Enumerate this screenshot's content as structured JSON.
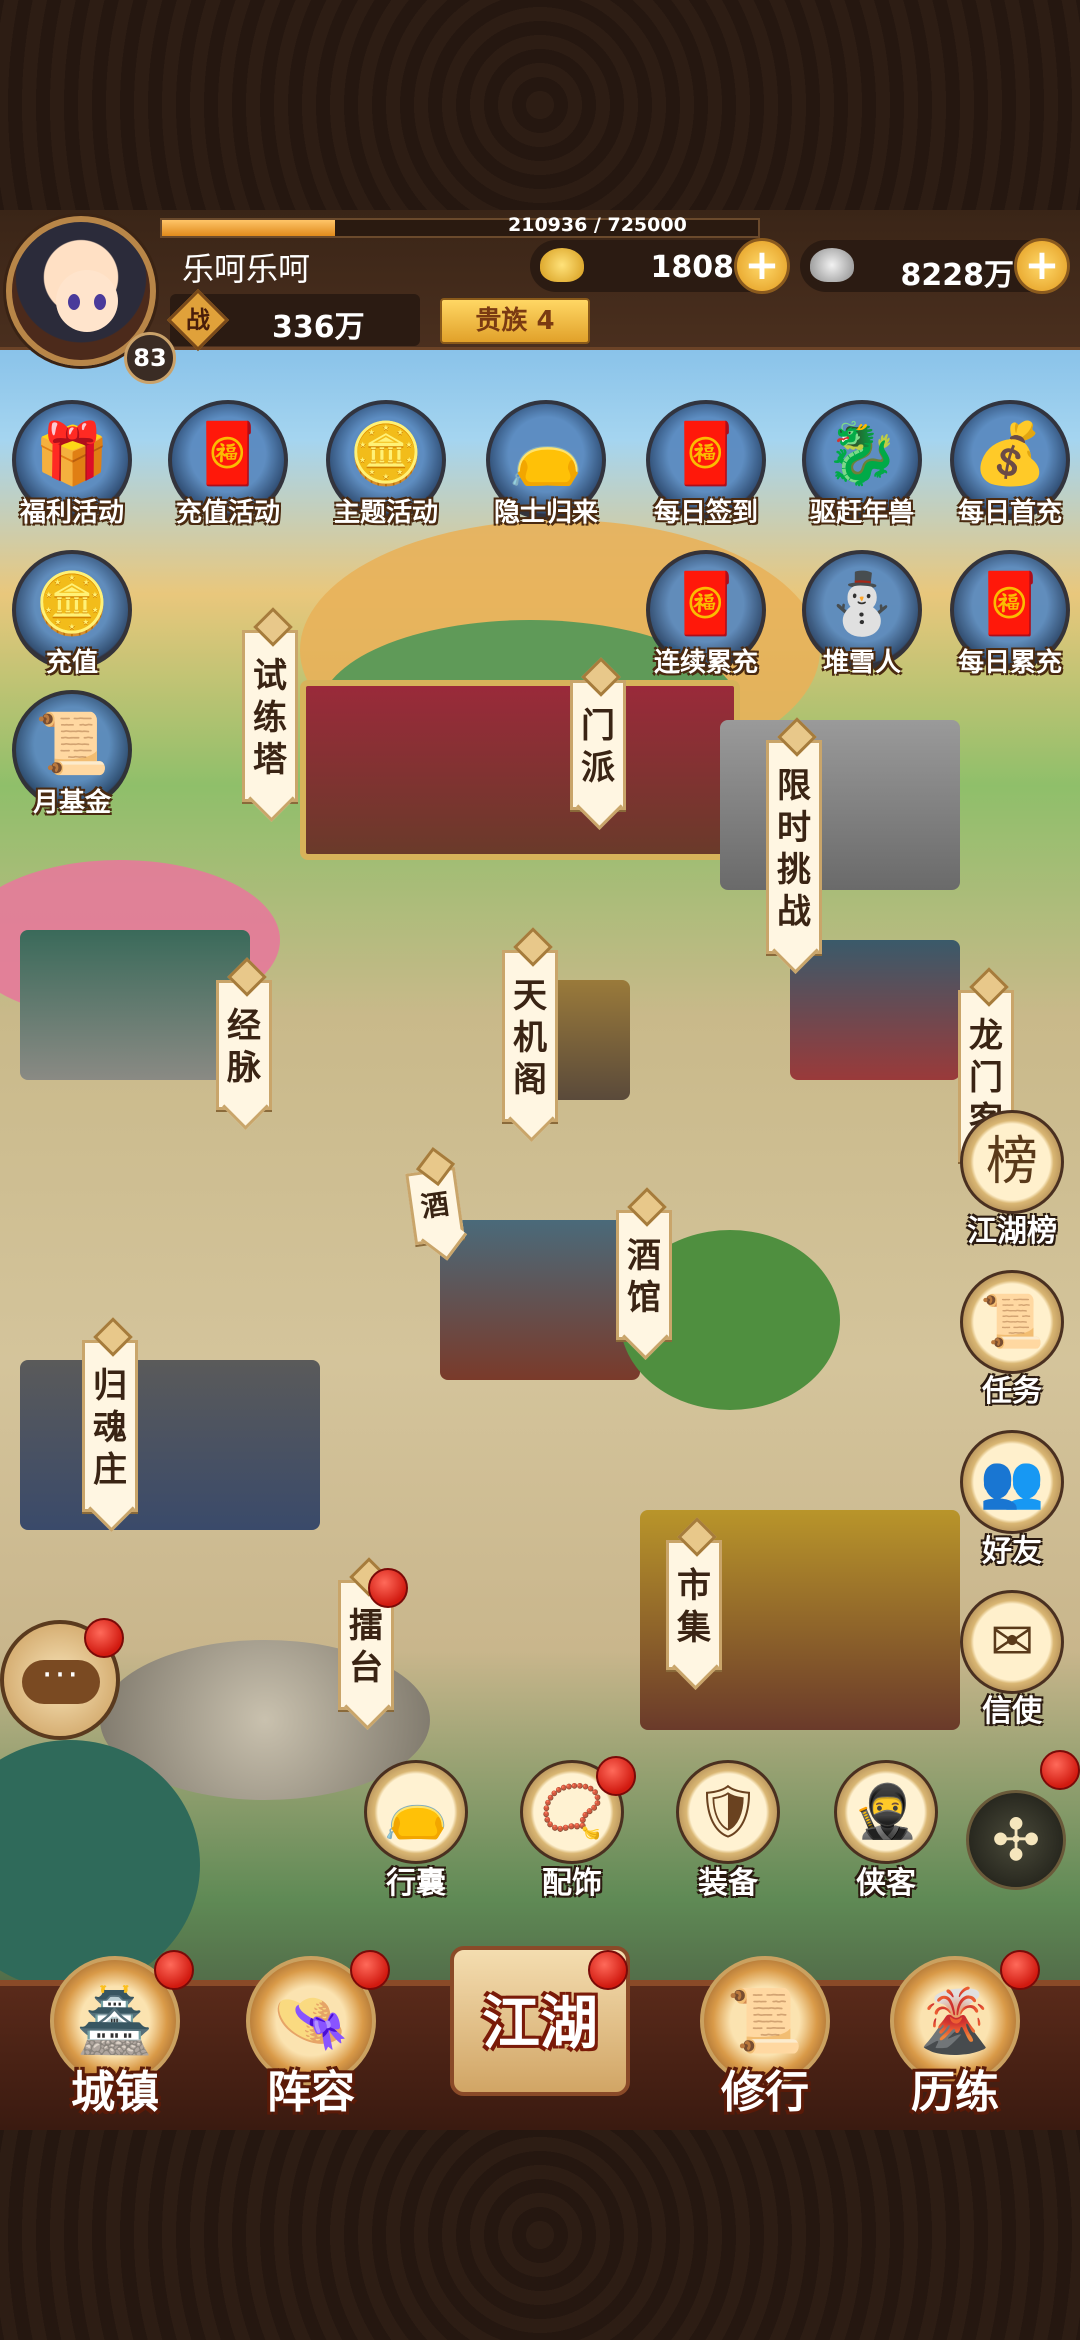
{
  "player": {
    "name": "乐呵乐呵",
    "level": "83",
    "exp_text": "210936 / 725000",
    "exp_progress": 0.29,
    "power_icon": "战",
    "power": "336万",
    "noble": "贵族 4"
  },
  "currency": {
    "gold": "1808",
    "silver": "8228万",
    "plus": "+"
  },
  "events": [
    {
      "label": "福利活动",
      "icon": "gift-pot-icon",
      "glyph": "🎁"
    },
    {
      "label": "充值活动",
      "icon": "red-packet-icon",
      "glyph": "🧧"
    },
    {
      "label": "主题活动",
      "icon": "gold-ingot-icon",
      "glyph": "🪙"
    },
    {
      "label": "隐士归来",
      "icon": "fortune-bag-icon",
      "glyph": "👝"
    },
    {
      "label": "每日签到",
      "icon": "red-packet-icon",
      "glyph": "🧧"
    },
    {
      "label": "驱赶年兽",
      "icon": "nian-beast-icon",
      "glyph": "🐉"
    },
    {
      "label": "每日首充",
      "icon": "gold-ingot-icon",
      "glyph": "💰"
    },
    {
      "label": "充值",
      "icon": "gold-ingot-icon",
      "glyph": "🪙"
    },
    {
      "label": "连续累充",
      "icon": "red-envelope-icon",
      "glyph": "🧧"
    },
    {
      "label": "堆雪人",
      "icon": "snowman-icon",
      "glyph": "⛄"
    },
    {
      "label": "每日累充",
      "icon": "red-envelope-icon",
      "glyph": "🧧"
    },
    {
      "label": "月基金",
      "icon": "scroll-sword-icon",
      "glyph": "📜"
    }
  ],
  "buildings": {
    "trial_tower": "试练塔",
    "sect": "门派",
    "timed_challenge": "限时挑战",
    "meridian": "经脉",
    "tianji": "天机阁",
    "longmen": "龙门客",
    "tavern": "酒馆",
    "tavern_flag": "酒",
    "guihun": "归魂庄",
    "arena": "擂台",
    "market": "市集"
  },
  "side_buttons": [
    {
      "label": "江湖榜",
      "icon": "ranking-icon",
      "glyph": "榜"
    },
    {
      "label": "任务",
      "icon": "quest-scroll-icon",
      "glyph": "📜"
    },
    {
      "label": "好友",
      "icon": "friends-icon",
      "glyph": "👥"
    },
    {
      "label": "信使",
      "icon": "letter-icon",
      "glyph": "✉"
    }
  ],
  "quick_buttons": [
    {
      "label": "行囊",
      "icon": "bag-icon",
      "glyph": "👝"
    },
    {
      "label": "配饰",
      "icon": "accessory-icon",
      "glyph": "📿"
    },
    {
      "label": "装备",
      "icon": "armor-icon",
      "glyph": "🛡"
    },
    {
      "label": "侠客",
      "icon": "hero-icon",
      "glyph": "🥷"
    }
  ],
  "chat": {
    "icon": "chat-icon",
    "glyph": "···"
  },
  "expand": {
    "icon": "expand-menu-icon",
    "glyph": "✣"
  },
  "nav": [
    {
      "label": "城镇",
      "icon": "town-icon",
      "glyph": "🏯"
    },
    {
      "label": "阵容",
      "icon": "lineup-icon",
      "glyph": "👒"
    },
    {
      "label": "江湖",
      "icon": "jianghu-scroll-icon",
      "glyph": ""
    },
    {
      "label": "修行",
      "icon": "cultivation-icon",
      "glyph": "📜"
    },
    {
      "label": "历练",
      "icon": "training-icon",
      "glyph": "🌋"
    }
  ],
  "colors": {
    "accent_gold": "#e8a72a",
    "badge_red": "#d11a10",
    "hud_brown": "#3a2517"
  }
}
